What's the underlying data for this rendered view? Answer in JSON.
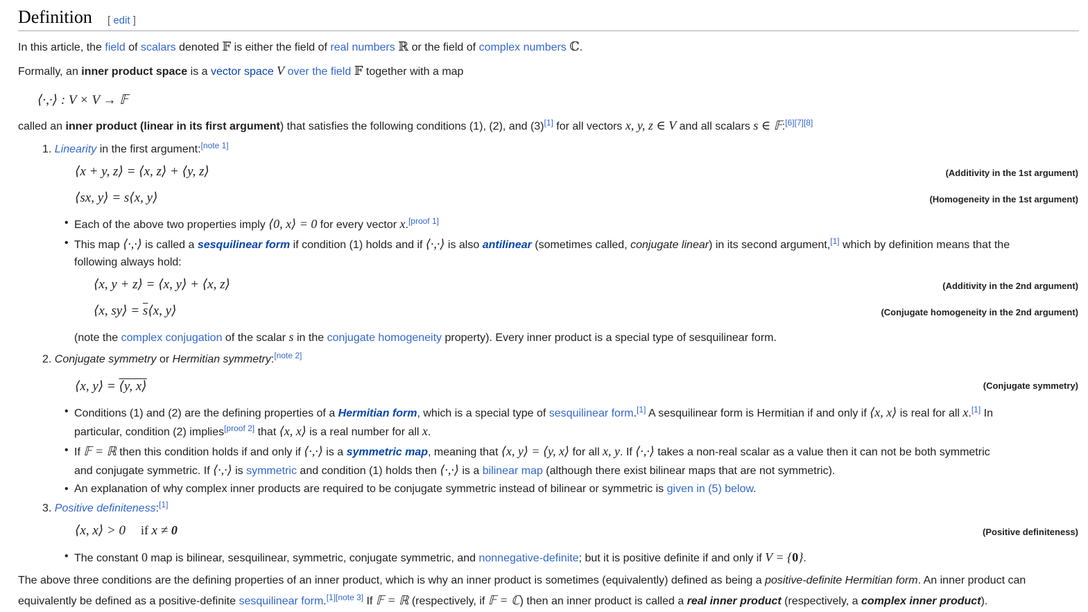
{
  "heading": {
    "title": "Definition",
    "edit_open": "[ ",
    "edit_label": "edit",
    "edit_close": " ]"
  },
  "p1": {
    "t1": "In this article, the ",
    "link_field": "field",
    "t2": " of ",
    "link_scalars": "scalars",
    "t3": " denoted ",
    "F": "𝔽",
    "t4": " is either the field of ",
    "link_real": "real numbers",
    "R": "ℝ",
    "t5": " or the field of ",
    "link_complex": "complex numbers",
    "C": "ℂ",
    "t6": "."
  },
  "p2": {
    "t1": "Formally, an ",
    "bold_ips": "inner product space",
    "t2": " is a ",
    "link_vector_space": "vector space",
    "V": "V",
    "link_over_field": "over the field",
    "F": "𝔽",
    "t3": " together with a map"
  },
  "map_formula": "⟨·,·⟩ : V × V → 𝔽",
  "p3": {
    "t1": "called an ",
    "bold_ip": "inner product (linear in its first argument",
    "t2": ") that satisfies the following conditions (1), (2), and (3)",
    "ref1": "[1]",
    "t3": " for all vectors ",
    "vars": "x, y, z ∈ V",
    "t4": " and all scalars ",
    "scalar": "s ∈ 𝔽",
    "t5": ":",
    "refs": "[6][7][8]"
  },
  "item1": {
    "num": "1.",
    "link": "Linearity",
    "text": " in the first argument:",
    "note": "[note 1]",
    "eq1": "⟨x + y, z⟩ = ⟨x, z⟩ + ⟨y, z⟩",
    "tag1": "(Additivity in the 1st argument)",
    "eq2": "⟨sx, y⟩ = s⟨x, y⟩",
    "tag2": "(Homogeneity in the 1st argument)",
    "b1_t1": "Each of the above two properties imply ",
    "b1_math": "⟨0, x⟩ = 0",
    "b1_t2": " for every vector ",
    "b1_x": "x",
    "b1_t3": ".",
    "b1_proof": "[proof 1]",
    "b2_t1": "This map ",
    "b2_m1": "⟨·,·⟩",
    "b2_t2": " is called a ",
    "b2_link1": "sesquilinear form",
    "b2_t3": " if condition (1) holds and if ",
    "b2_m2": "⟨·,·⟩",
    "b2_t4": " is also ",
    "b2_link2": "antilinear",
    "b2_t5": " (sometimes called, ",
    "b2_i": "conjugate linear",
    "b2_t6": ") in its second argument,",
    "b2_ref": "[1]",
    "b2_t7": " which by definition means that the",
    "b2_line2": "following always hold:",
    "eq3": "⟨x, y + z⟩ = ⟨x, y⟩ + ⟨x, z⟩",
    "tag3": "(Additivity in the 2nd argument)",
    "eq4a": "⟨x, sy⟩ = ",
    "eq4s": "s",
    "eq4b": "⟨x, y⟩",
    "tag4": "(Conjugate homogeneity in the 2nd argument)",
    "note_t1": "(note the ",
    "note_link1": "complex conjugation",
    "note_t2": " of the scalar ",
    "note_s": "s",
    "note_t3": " in the ",
    "note_link2": "conjugate homogeneity",
    "note_t4": " property). Every inner product is a special type of sesquilinear form."
  },
  "item2": {
    "num": "2.",
    "i1": "Conjugate symmetry",
    "t1": " or ",
    "i2": "Hermitian symmetry",
    "t2": ":",
    "note": "[note 2]",
    "eq_a": "⟨x, y⟩ = ",
    "eq_b": "⟨y, x⟩",
    "tag": "(Conjugate symmetry)",
    "b1_t1": "Conditions (1) and (2) are the defining properties of a ",
    "b1_link1": "Hermitian form",
    "b1_t2": ", which is a special type of ",
    "b1_link2": "sesquilinear form",
    "b1_t3": ".",
    "b1_ref1": "[1]",
    "b1_t4": " A sesquilinear form is Hermitian if and only if ",
    "b1_m1": "⟨x, x⟩",
    "b1_t5": " is real for all ",
    "b1_x": "x",
    "b1_t6": ".",
    "b1_ref2": "[1]",
    "b1_t7": " In",
    "b1_l2_t1": "particular, condition (2) implies",
    "b1_l2_proof": "[proof 2]",
    "b1_l2_t2": " that ",
    "b1_l2_m": "⟨x, x⟩",
    "b1_l2_t3": " is a real number for all ",
    "b1_l2_x": "x",
    "b1_l2_t4": ".",
    "b2_t1": "If ",
    "b2_m1": "𝔽 = ℝ",
    "b2_t2": " then this condition holds if and only if ",
    "b2_m2": "⟨·,·⟩",
    "b2_t3": " is a ",
    "b2_link1": "symmetric map",
    "b2_t4": ", meaning that ",
    "b2_m3": "⟨x, y⟩ = ⟨y, x⟩",
    "b2_t5": " for all ",
    "b2_m4": "x, y",
    "b2_t6": ". If ",
    "b2_m5": "⟨·,·⟩",
    "b2_t7": " takes a non-real scalar as a value then it can not be both symmetric",
    "b2_l2_t1": "and conjugate symmetric. If ",
    "b2_l2_m1": "⟨·,·⟩",
    "b2_l2_t2": " is ",
    "b2_l2_link1": "symmetric",
    "b2_l2_t3": " and condition (1) holds then ",
    "b2_l2_m2": "⟨·,·⟩",
    "b2_l2_t4": " is a ",
    "b2_l2_link2": "bilinear map",
    "b2_l2_t5": " (although there exist bilinear maps that are not symmetric).",
    "b3_t1": "An explanation of why complex inner products are required to be conjugate symmetric instead of bilinear or symmetric is ",
    "b3_link": "given in (5) below",
    "b3_t2": "."
  },
  "item3": {
    "num": "3.",
    "link": "Positive definiteness",
    "t1": ":",
    "ref": "[1]",
    "eq_a": "⟨x, x⟩ > 0",
    "eq_if": "if ",
    "eq_b": "x ≠ ",
    "eq_zero": "0",
    "tag": "(Positive definiteness)",
    "b1_t1": "The constant ",
    "b1_zero": "0",
    "b1_t2": " map is bilinear, sesquilinear, symmetric, conjugate symmetric, and ",
    "b1_link": "nonnegative-definite",
    "b1_t3": "; but it is positive definite if and only if ",
    "b1_m": "V = {",
    "b1_m0": "0",
    "b1_m2": "}",
    "b1_t4": "."
  },
  "p4": {
    "t1": "The above three conditions are the defining properties of an inner product, which is why an inner product is sometimes (equivalently) defined as being a ",
    "i1": "positive-definite Hermitian form",
    "t2": ". An inner product can",
    "l2_t1": "equivalently be defined as a positive-definite ",
    "l2_link": "sesquilinear form",
    "l2_t2": ".",
    "l2_refs": "[1][note 3]",
    "l2_t3": " If ",
    "l2_m1": "𝔽 = ℝ",
    "l2_t4": " (respectively, if ",
    "l2_m2": "𝔽 = ℂ",
    "l2_t5": ") then an inner product is called a ",
    "l2_b1": "real inner product",
    "l2_t6": " (respectively, a ",
    "l2_b2": "complex inner product",
    "l2_t7": ")."
  }
}
